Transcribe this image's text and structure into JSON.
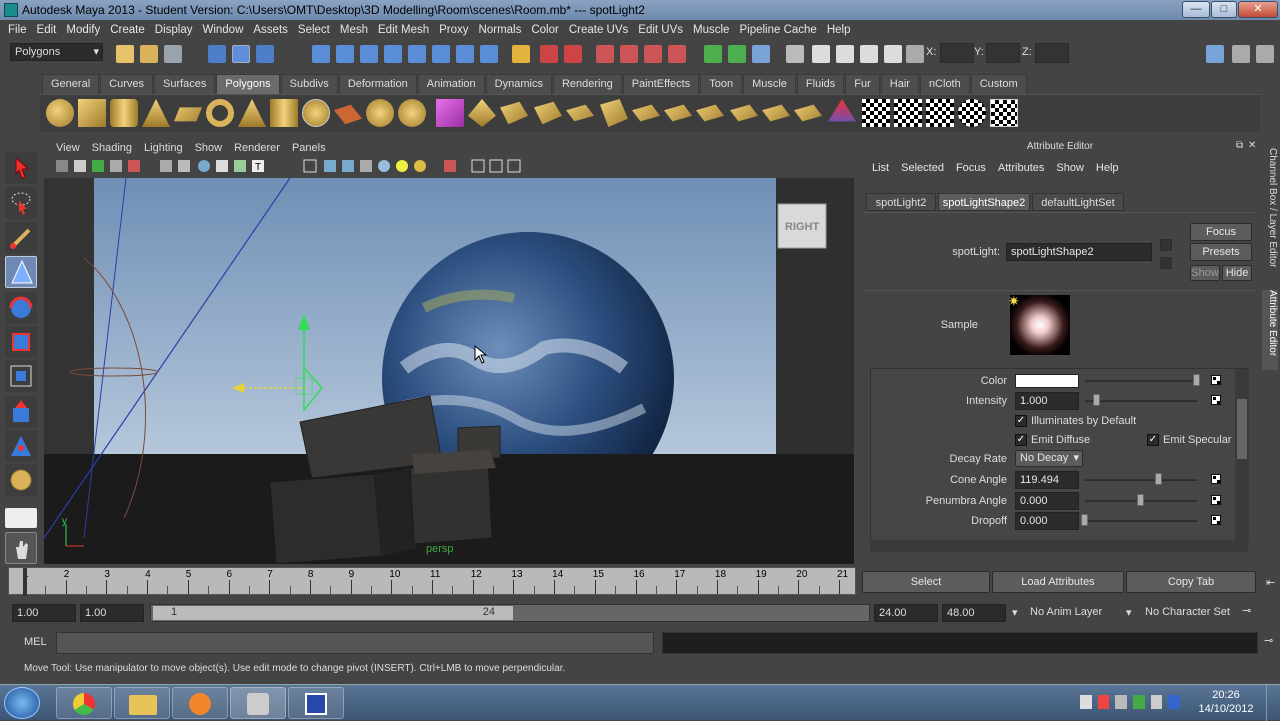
{
  "window": {
    "title": "Autodesk Maya 2013 - Student Version: C:\\Users\\OMT\\Desktop\\3D Modelling\\Room\\scenes\\Room.mb*   ---   spotLight2",
    "minimize": "—",
    "maximize": "□",
    "close": "✕"
  },
  "menubar": [
    "File",
    "Edit",
    "Modify",
    "Create",
    "Display",
    "Window",
    "Assets",
    "Select",
    "Mesh",
    "Edit Mesh",
    "Proxy",
    "Normals",
    "Color",
    "Create UVs",
    "Edit UVs",
    "Muscle",
    "Pipeline Cache",
    "Help"
  ],
  "statusline": {
    "mode": "Polygons",
    "x_label": "X:",
    "y_label": "Y:",
    "z_label": "Z:"
  },
  "shelf_tabs": [
    "General",
    "Curves",
    "Surfaces",
    "Polygons",
    "Subdivs",
    "Deformation",
    "Animation",
    "Dynamics",
    "Rendering",
    "PaintEffects",
    "Toon",
    "Muscle",
    "Fluids",
    "Fur",
    "Hair",
    "nCloth",
    "Custom"
  ],
  "shelf_active": "Polygons",
  "viewport": {
    "menu": [
      "View",
      "Shading",
      "Lighting",
      "Show",
      "Renderer",
      "Panels"
    ],
    "camera_label": "persp",
    "cube_label": "RIGHT",
    "axis_y": "y"
  },
  "attribute_editor": {
    "title": "Attribute Editor",
    "menu": [
      "List",
      "Selected",
      "Focus",
      "Attributes",
      "Show",
      "Help"
    ],
    "tabs": [
      "spotLight2",
      "spotLightShape2",
      "defaultLightSet"
    ],
    "active_tab": "spotLightShape2",
    "node_type_label": "spotLight:",
    "node_name": "spotLightShape2",
    "focus_btn": "Focus",
    "presets_btn": "Presets",
    "show_btn": "Show",
    "hide_btn": "Hide",
    "sample_label": "Sample",
    "color_label": "Color",
    "intensity_label": "Intensity",
    "intensity": "1.000",
    "illuminates": "Illuminates by Default",
    "emit_diffuse": "Emit Diffuse",
    "emit_specular": "Emit Specular",
    "decay_label": "Decay Rate",
    "decay_value": "No Decay",
    "cone_label": "Cone Angle",
    "cone_value": "119.494",
    "penumbra_label": "Penumbra Angle",
    "penumbra_value": "0.000",
    "dropoff_label": "Dropoff",
    "dropoff_value": "0.000",
    "select_btn": "Select",
    "load_btn": "Load Attributes",
    "copy_btn": "Copy Tab",
    "side_tab": "Channel Box / Layer Editor",
    "side_tab2": "Attribute Editor"
  },
  "timeline": {
    "ticks": [
      "1",
      "2",
      "3",
      "4",
      "5",
      "6",
      "7",
      "8",
      "9",
      "10",
      "11",
      "12",
      "13",
      "14",
      "15",
      "16",
      "17",
      "18",
      "19",
      "20",
      "21"
    ],
    "start": "1.00",
    "current": "1.00",
    "range_start": "1",
    "range_end": "24",
    "end": "24.00",
    "end2": "48.00",
    "anim_layer": "No Anim Layer",
    "char_set": "No Character Set"
  },
  "cmdline": {
    "label": "MEL"
  },
  "helpline": "Move Tool: Use manipulator to move object(s). Use edit mode to change pivot (INSERT).  Ctrl+LMB to move perpendicular.",
  "taskbar": {
    "time": "20:26",
    "date": "14/10/2012"
  },
  "colors": {
    "ui_bg": "#444444",
    "sky_top": "#6f8fb5",
    "sky_bottom": "#b5c7db",
    "manip_green": "#33dd55",
    "manip_yellow": "#e8d23a"
  }
}
